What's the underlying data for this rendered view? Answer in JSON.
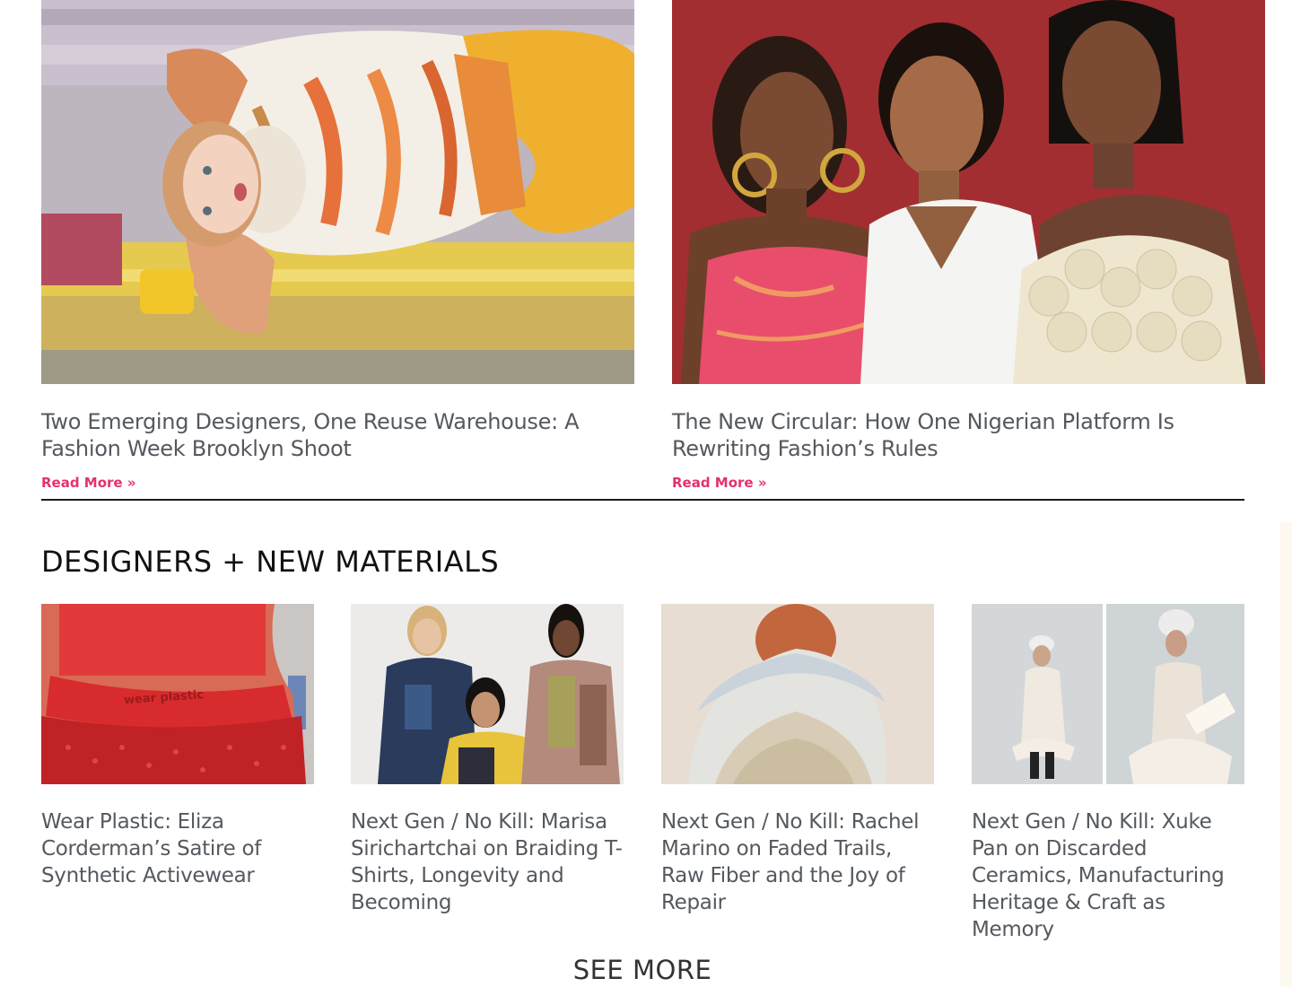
{
  "featured": [
    {
      "title": "Two Emerging Designers, One Reuse Warehouse: A Fashion Week Brooklyn Shoot",
      "read_more": "Read More »",
      "image_alt": "Model lying on fabric rolls wearing an orange felted knit outfit"
    },
    {
      "title": "The New Circular: How One Nigerian Platform Is Rewriting Fashion’s Rules",
      "read_more": "Read More »",
      "image_alt": "Three smiling women in front of a red backdrop"
    }
  ],
  "section": {
    "heading": "DESIGNERS + NEW MATERIALS"
  },
  "grid": [
    {
      "title": "Wear Plastic: Eliza Corderman’s Satire of Synthetic Activewear",
      "image_text": "wear plastic",
      "image_alt": "Red sequined skirt with wear plastic waistband"
    },
    {
      "title": "Next Gen / No Kill: Marisa Sirichartchai on Braiding T-Shirts, Longevity and Becoming",
      "image_alt": "Three models in upcycled patchwork jackets"
    },
    {
      "title": "Next Gen / No Kill: Rachel Marino on Faded Trails, Raw Fiber and the Joy of Repair",
      "image_alt": "Person in felted raw fiber collar"
    },
    {
      "title": "Next Gen / No Kill: Xuke Pan on Discarded Ceramics, Manufacturing Heritage & Craft as Memory",
      "image_alt": "Two models in white ceramic-inspired garments"
    }
  ],
  "see_more": "SEE MORE",
  "colors": {
    "accent": "#e6306e",
    "title_text": "#54595f",
    "heading_text": "#111111",
    "divider": "#1c1c1c"
  }
}
